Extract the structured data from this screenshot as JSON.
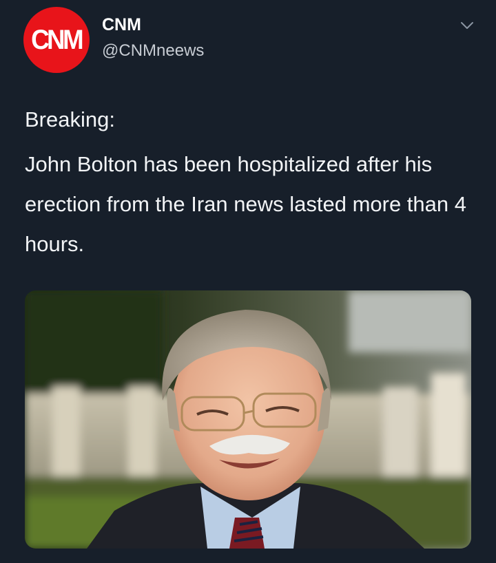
{
  "tweet": {
    "avatar_logo": "CNM",
    "display_name": "CNM",
    "handle": "@CNMneews",
    "text_line1": "Breaking:",
    "text_body": "John Bolton has been hospitalized after his erection from the Iran news lasted more than 4 hours.",
    "menu_icon": "chevron-down-icon",
    "media_icon": "photo"
  },
  "colors": {
    "background": "#171f2a",
    "avatar_red": "#e8141a",
    "text_primary": "#f2f4f6",
    "text_secondary": "#c7ccd3"
  }
}
